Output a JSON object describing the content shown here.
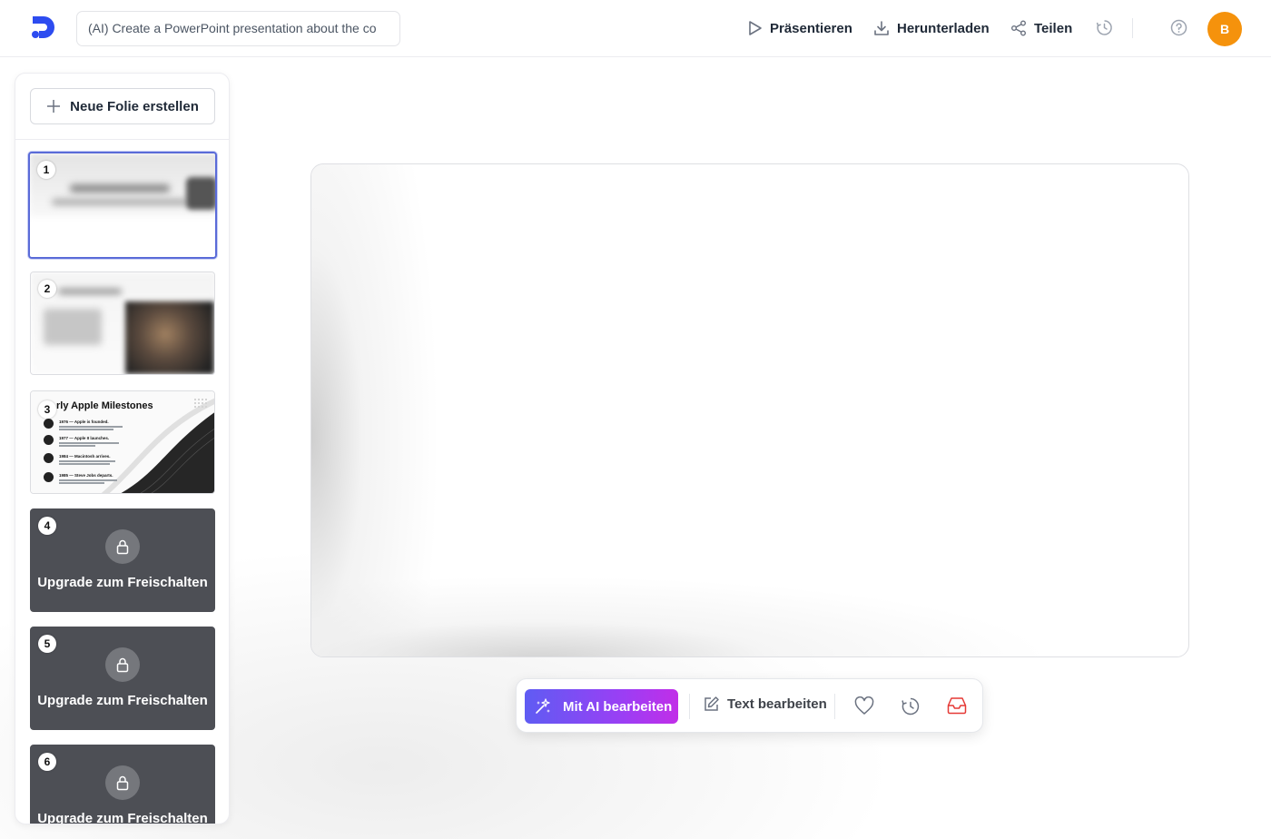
{
  "header": {
    "prompt_value": "(AI) Create a PowerPoint presentation about the co",
    "present_label": "Präsentieren",
    "download_label": "Herunterladen",
    "share_label": "Teilen",
    "avatar_initial": "B"
  },
  "sidebar": {
    "new_slide_label": "Neue Folie erstellen",
    "slides": [
      {
        "number": "1",
        "locked": false
      },
      {
        "number": "2",
        "locked": false
      },
      {
        "number": "3",
        "locked": false,
        "title": "rly Apple Milestones",
        "items": [
          "1976 — Apple is founded.",
          "1977 — Apple II launches.",
          "1984 — Macintosh arrives.",
          "1985 — Steve Jobs departs."
        ]
      },
      {
        "number": "4",
        "locked": true,
        "lock_label": "Upgrade zum Freischalten"
      },
      {
        "number": "5",
        "locked": true,
        "lock_label": "Upgrade zum Freischalten"
      },
      {
        "number": "6",
        "locked": true,
        "lock_label": "Upgrade zum Freischalten"
      }
    ]
  },
  "toolbar": {
    "ai_edit_label": "Mit AI bearbeiten",
    "text_edit_label": "Text bearbeiten"
  },
  "colors": {
    "accent": "#5f5cf3",
    "avatar": "#f5920c",
    "locked_bg": "#4d4f55",
    "selected_border": "#5a6bd8"
  }
}
